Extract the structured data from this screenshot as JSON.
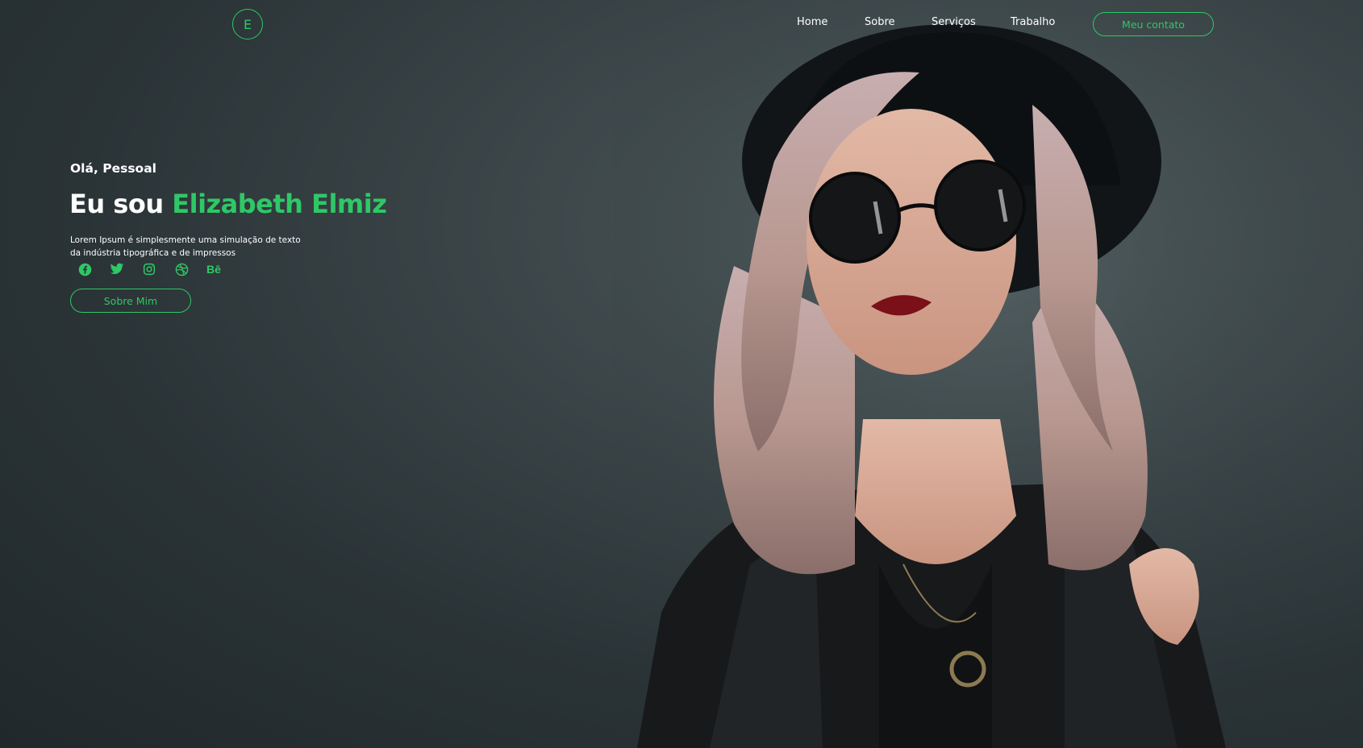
{
  "header": {
    "logo_letter": "E",
    "nav": [
      {
        "label": "Home"
      },
      {
        "label": "Sobre"
      },
      {
        "label": "Serviços"
      },
      {
        "label": "Trabalho"
      }
    ],
    "contact_label": "Meu contato"
  },
  "hero": {
    "greeting": "Olá, Pessoal",
    "headline_prefix": "Eu sou",
    "headline_name": "Elizabeth Elmiz",
    "description_line1": "Lorem Ipsum é simplesmente uma simulação de texto",
    "description_line2": "da indústria tipográfica e de impressos",
    "socials": [
      {
        "icon": "facebook-icon"
      },
      {
        "icon": "twitter-icon"
      },
      {
        "icon": "instagram-icon"
      },
      {
        "icon": "dribbble-icon"
      },
      {
        "icon": "behance-icon",
        "text": "Bē"
      }
    ],
    "cta_label": "Sobre Mim"
  },
  "theme": {
    "accent": "#2ec866",
    "background": "#2b3437",
    "text": "#ffffff"
  }
}
